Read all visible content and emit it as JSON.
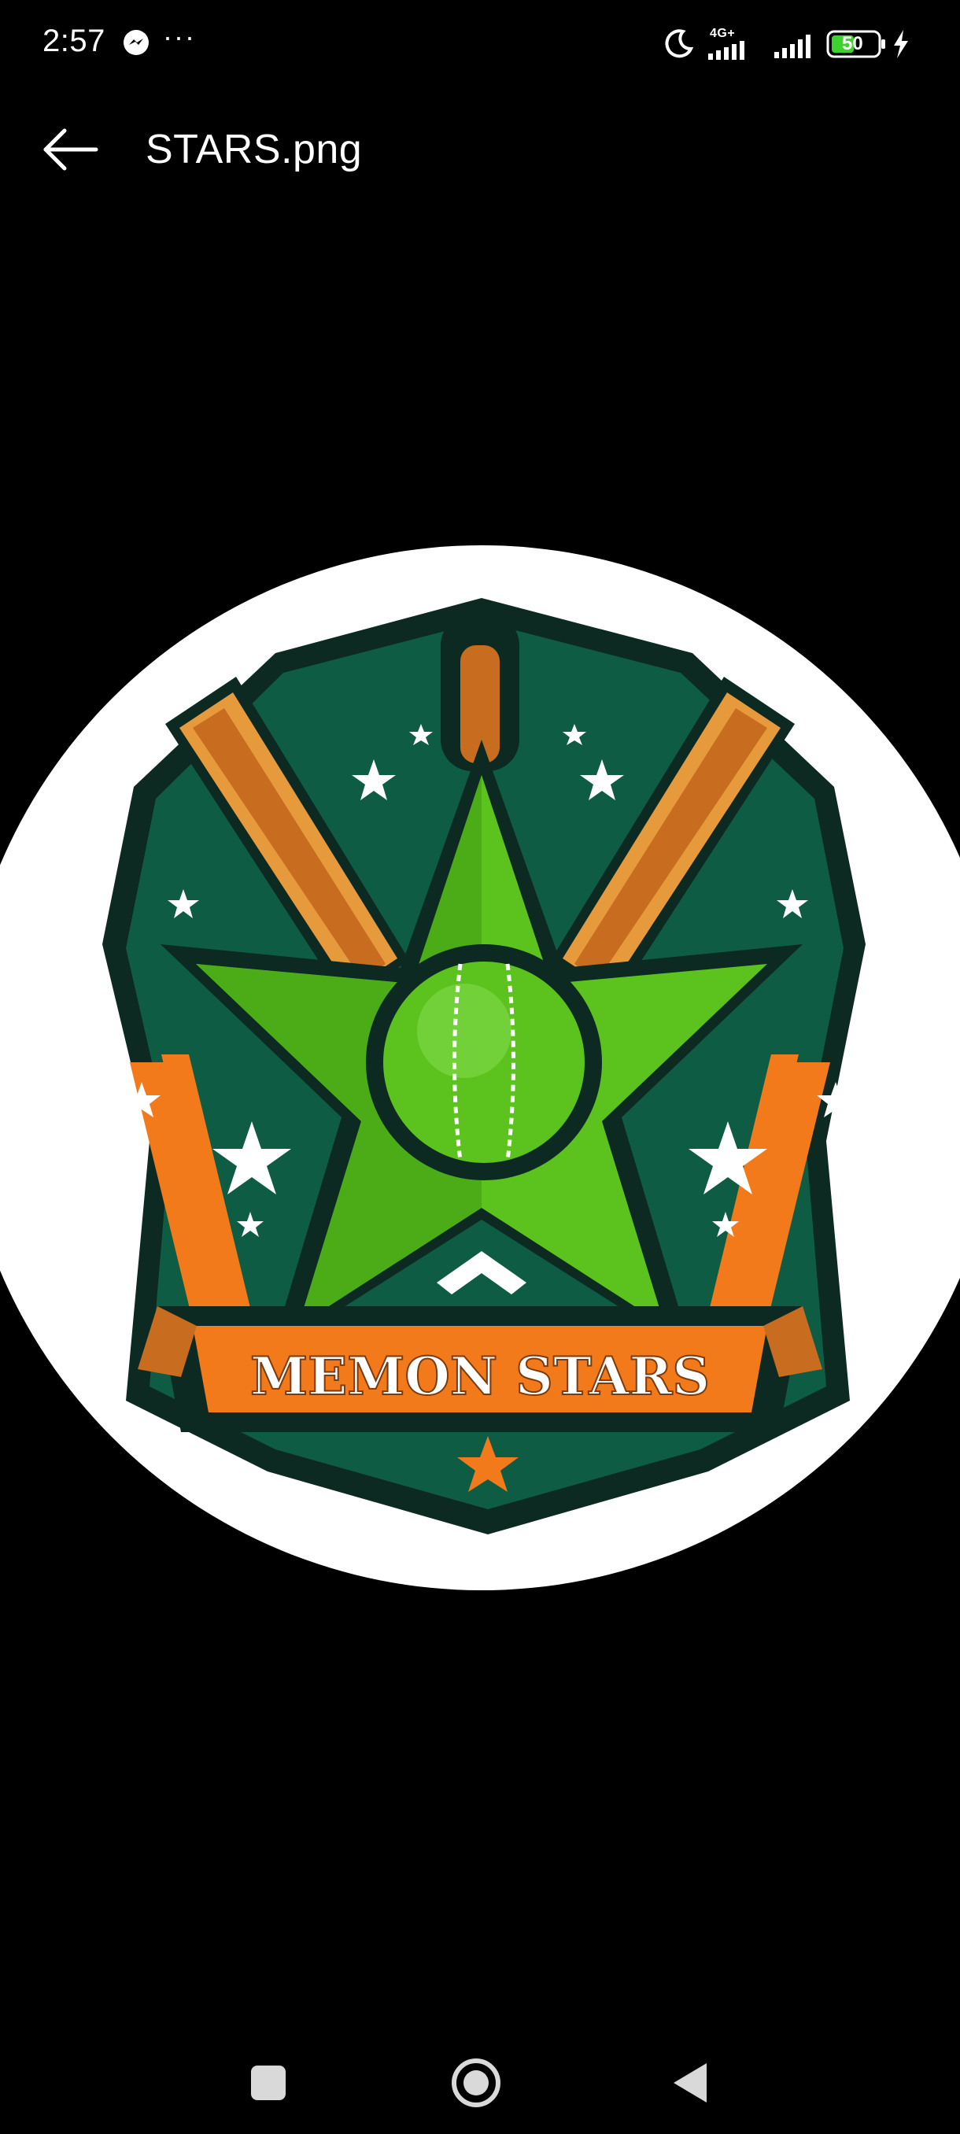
{
  "status_bar": {
    "time": "2:57",
    "more": "···",
    "network_type": "4G+",
    "battery_level": "50",
    "icons": [
      "messenger-icon",
      "do-not-disturb-moon-icon",
      "signal-4g-icon",
      "signal-icon",
      "battery-icon",
      "charging-bolt-icon"
    ]
  },
  "app_bar": {
    "back_icon": "arrow-left-icon",
    "title": "STARS.png"
  },
  "image": {
    "description_none": "",
    "logo_banner_text": "MEMON STARS",
    "colors": {
      "dark_green": "#0f5c45",
      "bright_green": "#5cc21d",
      "orange": "#f27a1a",
      "outline": "#0c2a22",
      "wood": "#e69a3c",
      "white": "#ffffff"
    }
  },
  "nav_bar": {
    "icons": [
      "recent-apps-square-icon",
      "home-circle-icon",
      "back-triangle-icon"
    ]
  }
}
